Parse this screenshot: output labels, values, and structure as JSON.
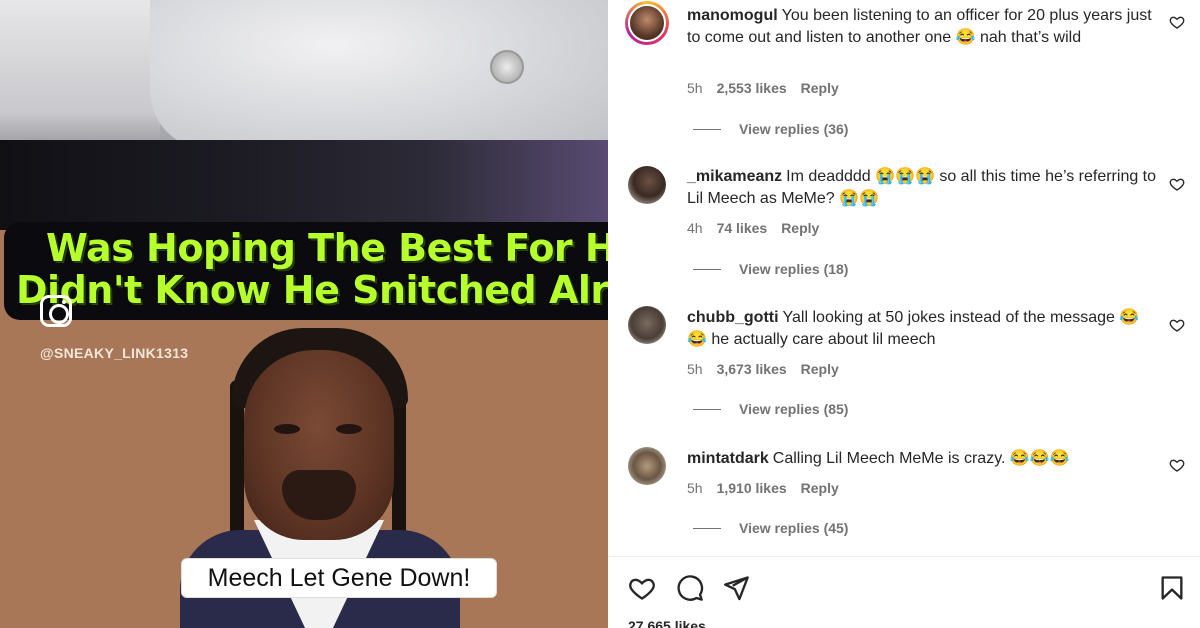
{
  "media": {
    "caption_line_1": "Was Hoping The Best For Him",
    "caption_line_2": "Didn't Know He Snitched Already",
    "handle": "@SNEAKY_LINK1313",
    "subtitle": "Meech Let Gene Down!",
    "caption_color": "#b6ff2c"
  },
  "comments": [
    {
      "username": "manomogul",
      "text": "You been listening to an officer for 20 plus years just to come out and listen to another one 😂 nah that’s wild",
      "time": "5h",
      "likes": "2,553 likes",
      "reply_label": "Reply",
      "view_replies": "View replies (36)",
      "has_story": true
    },
    {
      "username": "_mikameanz",
      "text": "Im deadddd 😭😭😭 so all this time he’s referring to Lil Meech as MeMe? 😭😭",
      "time": "4h",
      "likes": "74 likes",
      "reply_label": "Reply",
      "view_replies": "View replies (18)",
      "has_story": false
    },
    {
      "username": "chubb_gotti",
      "text": "Yall looking at 50 jokes instead of the message 😂😂 he actually care about lil meech",
      "time": "5h",
      "likes": "3,673 likes",
      "reply_label": "Reply",
      "view_replies": "View replies (85)",
      "has_story": false
    },
    {
      "username": "mintatdark",
      "text": "Calling Lil Meech MeMe is crazy. 😂😂😂",
      "time": "5h",
      "likes": "1,910 likes",
      "reply_label": "Reply",
      "view_replies": "View replies (45)",
      "has_story": false
    }
  ],
  "actions": {
    "like_icon": "heart-icon",
    "comment_icon": "comment-bubble-icon",
    "share_icon": "paper-plane-icon",
    "save_icon": "bookmark-icon"
  },
  "footer": {
    "likes_count": "27,665 likes"
  },
  "colors": {
    "text": "#262626",
    "muted": "#737373",
    "story_ring": "#e9335e"
  }
}
